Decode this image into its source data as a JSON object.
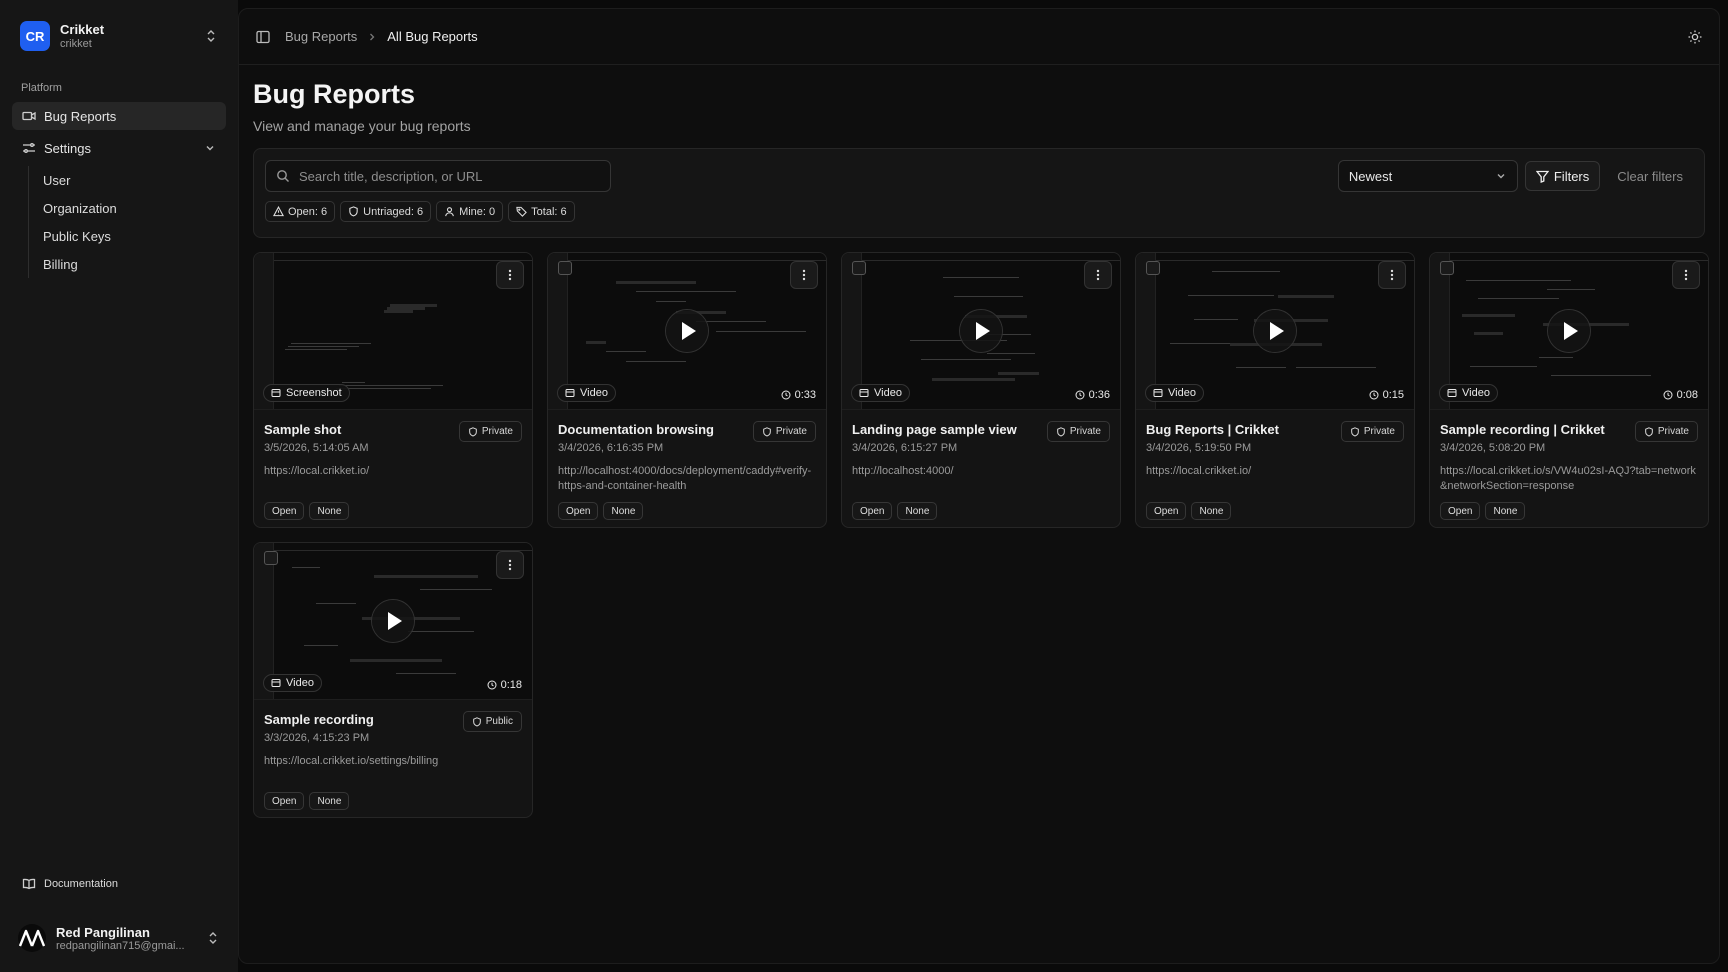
{
  "org": {
    "initials": "CR",
    "name": "Crikket",
    "slug": "crikket"
  },
  "sidebar": {
    "section_label": "Platform",
    "items": [
      {
        "label": "Bug Reports",
        "icon": "video-icon",
        "active": true
      },
      {
        "label": "Settings",
        "icon": "settings-sliders-icon"
      }
    ],
    "settings_children": [
      "User",
      "Organization",
      "Public Keys",
      "Billing"
    ],
    "documentation_label": "Documentation"
  },
  "user": {
    "name": "Red Pangilinan",
    "email": "redpangilinan715@gmai..."
  },
  "breadcrumb": {
    "parent": "Bug Reports",
    "current": "All Bug Reports"
  },
  "page": {
    "title": "Bug Reports",
    "subtitle": "View and manage your bug reports"
  },
  "filters": {
    "search_placeholder": "Search title, description, or URL",
    "sort_value": "Newest",
    "filters_label": "Filters",
    "clear_label": "Clear filters",
    "stats": [
      {
        "label": "Open: 6",
        "icon": "alert-triangle-icon"
      },
      {
        "label": "Untriaged: 6",
        "icon": "shield-icon"
      },
      {
        "label": "Mine: 0",
        "icon": "user-icon"
      },
      {
        "label": "Total: 6",
        "icon": "tag-icon"
      }
    ]
  },
  "reports": [
    {
      "type": "Screenshot",
      "duration": "",
      "title": "Sample shot",
      "date": "3/5/2026, 5:14:05 AM",
      "url": "https://local.crikket.io/",
      "visibility": "Private",
      "status": "Open",
      "priority": "None"
    },
    {
      "type": "Video",
      "duration": "0:33",
      "title": "Documentation browsing",
      "date": "3/4/2026, 6:16:35 PM",
      "url": "http://localhost:4000/docs/deployment/caddy#verify-https-and-container-health",
      "visibility": "Private",
      "status": "Open",
      "priority": "None"
    },
    {
      "type": "Video",
      "duration": "0:36",
      "title": "Landing page sample view",
      "date": "3/4/2026, 6:15:27 PM",
      "url": "http://localhost:4000/",
      "visibility": "Private",
      "status": "Open",
      "priority": "None"
    },
    {
      "type": "Video",
      "duration": "0:15",
      "title": "Bug Reports | Crikket",
      "date": "3/4/2026, 5:19:50 PM",
      "url": "https://local.crikket.io/",
      "visibility": "Private",
      "status": "Open",
      "priority": "None"
    },
    {
      "type": "Video",
      "duration": "0:08",
      "title": "Sample recording | Crikket",
      "date": "3/4/2026, 5:08:20 PM",
      "url": "https://local.crikket.io/s/VW4u02sI-AQJ?tab=network&networkSection=response",
      "visibility": "Private",
      "status": "Open",
      "priority": "None"
    },
    {
      "type": "Video",
      "duration": "0:18",
      "title": "Sample recording",
      "date": "3/3/2026, 4:15:23 PM",
      "url": "https://local.crikket.io/settings/billing",
      "visibility": "Public",
      "status": "Open",
      "priority": "None"
    }
  ],
  "colors": {
    "brand": "#1f5ff0",
    "background": "#0a0a0a",
    "card": "#141414"
  }
}
